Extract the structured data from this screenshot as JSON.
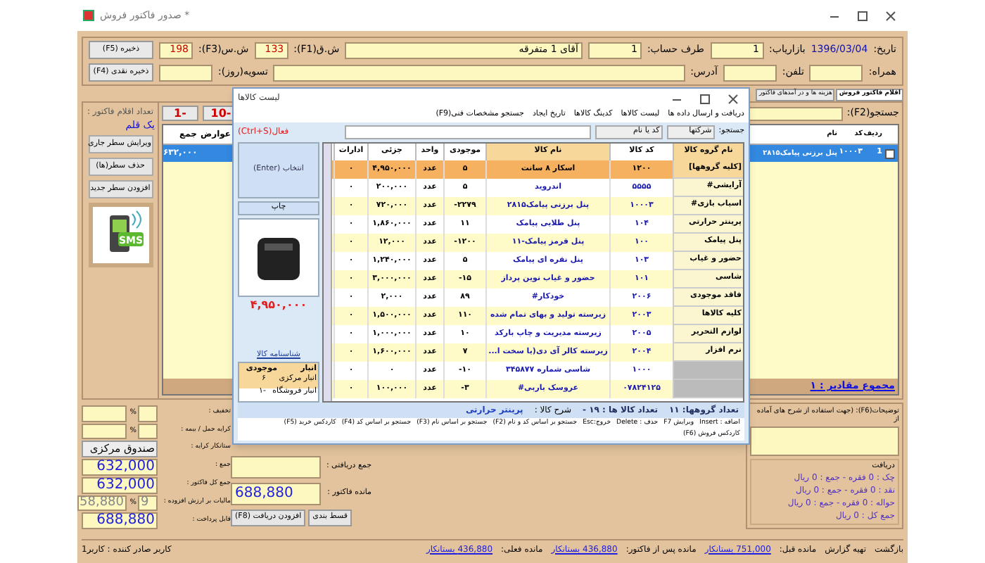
{
  "window": {
    "title": "صدور فاکتور فروش *"
  },
  "header": {
    "row1": [
      {
        "label": "تاریخ:",
        "value": "1396/03/04",
        "kind": "text"
      },
      {
        "label": "بازاریاب:",
        "value": "1",
        "kind": "field"
      },
      {
        "label": "طرف حساب:",
        "value": "1",
        "kind": "field"
      },
      {
        "value": "آقای 1 متفرقه",
        "kind": "wide"
      },
      {
        "label": "ش.ق(F1):",
        "value": "133",
        "kind": "red"
      },
      {
        "label": "ش.س(F3):",
        "value": "198",
        "kind": "red"
      }
    ],
    "save_button": "ذخیره (F5)",
    "row2": [
      {
        "label": "همراه:",
        "kind": "field"
      },
      {
        "label": "تلفن:",
        "kind": "field"
      },
      {
        "label": "آدرس:",
        "kind": "wide"
      },
      {
        "label": "تسویه(روز):",
        "kind": "field"
      }
    ],
    "cash_save_button": "ذخیره نقدی (F4)"
  },
  "tabs": [
    {
      "label": "اقلام فاکتور فروش",
      "selected": true
    },
    {
      "label": "هزینه ها و در آمدهای فاکتور",
      "selected": false
    }
  ],
  "search": {
    "label": "جستجو(F2):"
  },
  "step_buttons": [
    "-10",
    "-1"
  ],
  "side": {
    "count_label": "تعداد اقلام فاکتور :",
    "count": "یک قلم",
    "buttons": [
      "ویرایش سطر جاری",
      "حذف سطر(ها)",
      "افزودن سطر جدید"
    ],
    "sms_label": "SMS"
  },
  "grid": {
    "columns": [
      "ردیف",
      "کد",
      "نام",
      "عوارض",
      "جمع"
    ],
    "rows": [
      {
        "checked": false,
        "number": "1",
        "code": "۱۰۰۰۳",
        "name": "پنل برزنی پیامک۲۸۱۵",
        "total": "۶۳۲,۰۰۰",
        "selected": true
      }
    ],
    "footer": "مجموع مقادیر : ۱"
  },
  "dialog": {
    "title": "لیست کالاها",
    "menu": [
      "دریافت و ارسال داده ها",
      "لیست کالاها",
      "کدینگ کالاها",
      "تاریخ ایجاد",
      "جستجو مشخصات فنی(F9)"
    ],
    "search_label": "جستجو:",
    "combo1": "شرکتها",
    "combo2": "کد یا نام",
    "active_label": "فعال(Ctrl+S)",
    "select_button": "انتخاب (Enter)",
    "print_button": "چاپ",
    "price": "۴,۹۵۰,۰۰۰",
    "id_card_link": "شناسنامه کالا",
    "stock_columns": [
      "انبار",
      "موجودی"
    ],
    "stock": [
      {
        "store": "انبار مرکزی",
        "qty": "۶",
        "selected": true
      },
      {
        "store": "انبار فروشگاه",
        "qty": "-۱",
        "selected": false
      }
    ],
    "group_header": "نام گروه کالا",
    "groups": [
      "[کلیه گروهها]",
      "آرایشی#",
      "اسباب بازی#",
      "پرینتر حرارتی",
      "پنل پیامک",
      "حضور و غیاب",
      "شاسی",
      "فاقد موجودی",
      "کلیه کالاها",
      "لوازم التحریر",
      "نرم افزار"
    ],
    "columns": [
      "کد کالا",
      "نام کالا",
      "موجودی",
      "واحد",
      "جزئی",
      "ادارات"
    ],
    "items": [
      {
        "code": "۱۲۰۰",
        "name": "اسکار ۸ سانت",
        "qty": "۵",
        "unit": "عدد",
        "price": "۴,۹۵۰,۰۰۰",
        "dept": "۰",
        "selected": true
      },
      {
        "code": "۵۵۵۵",
        "name": "اندروید",
        "qty": "۵",
        "unit": "عدد",
        "price": "۲۰۰,۰۰۰",
        "dept": "۰",
        "selected": false
      },
      {
        "code": "۱۰۰۰۳",
        "name": "پنل برزنی پیامک۲۸۱۵",
        "qty": "۲۲۷۹-",
        "unit": "عدد",
        "price": "۷۲۰,۰۰۰",
        "dept": "۰",
        "selected": false
      },
      {
        "code": "۱۰۴",
        "name": "پنل طلایی پیامک",
        "qty": "۱۱",
        "unit": "عدد",
        "price": "۱,۸۶۰,۰۰۰",
        "dept": "۰",
        "selected": false
      },
      {
        "code": "۱۰۰",
        "name": "پنل قرمز پیامک-۱۱",
        "qty": "۱۲۰۰-",
        "unit": "عدد",
        "price": "۱۲,۰۰۰",
        "dept": "۰",
        "selected": false
      },
      {
        "code": "۱۰۳",
        "name": "پنل نقره ای پیامک",
        "qty": "۵",
        "unit": "عدد",
        "price": "۱,۲۴۰,۰۰۰",
        "dept": "۰",
        "selected": false
      },
      {
        "code": "۱۰۱",
        "name": "حضور و غیاب نوین پرداز",
        "qty": "۱۵-",
        "unit": "عدد",
        "price": "۳,۰۰۰,۰۰۰",
        "dept": "۰",
        "selected": false
      },
      {
        "code": "۲۰۰۶",
        "name": "خودکار#",
        "qty": "۸۹",
        "unit": "عدد",
        "price": "۲,۰۰۰",
        "dept": "۰",
        "selected": false
      },
      {
        "code": "۲۰۰۳",
        "name": "زیرسته تولید و بهای تمام شده",
        "qty": "۱۱۰",
        "unit": "عدد",
        "price": "۱,۵۰۰,۰۰۰",
        "dept": "۰",
        "selected": false
      },
      {
        "code": "۲۰۰۵",
        "name": "زیرسته مدیریت و چاپ بارکد",
        "qty": "۱۰",
        "unit": "عدد",
        "price": "۱,۰۰۰,۰۰۰",
        "dept": "۰",
        "selected": false
      },
      {
        "code": "۲۰۰۴",
        "name": "زیرسته کالر آی دی(با سخت ا...",
        "qty": "۷",
        "unit": "عدد",
        "price": "۱,۶۰۰,۰۰۰",
        "dept": "۰",
        "selected": false
      },
      {
        "code": "۱۰۰۰",
        "name": "شاسی شماره ۳۴۵۸۷۷",
        "qty": "۱۰-",
        "unit": "عدد",
        "price": "۰",
        "dept": "۰",
        "selected": false
      },
      {
        "code": "۰۷۸۲۴۱۲۵",
        "name": "عروسک باربی#",
        "qty": "۳-",
        "unit": "عدد",
        "price": "۱۰۰,۰۰۰",
        "dept": "۰",
        "selected": false
      }
    ],
    "group_count": "تعداد گروهها: ۱۱",
    "item_count": "تعداد کالا ها : ۱۹ -",
    "desc_label": "شرح کالا :",
    "desc": "پرینتر حرارتی",
    "shortcuts": [
      "اضافه : Insert",
      "ویرایش F7",
      "حذف : Delete",
      "خروج:Esc",
      "جستجو بر اساس کد و نام (F2)",
      "جستجو بر اساس نام (F3)",
      "جستجو بر اساس کد (F4)",
      "کاردکس خرید (F5)",
      "کاردکس فروش (F6)"
    ]
  },
  "totals": {
    "discount_label": "تخفیف :",
    "freight_label": "کرایه حمل / بیمه :",
    "percent": "%",
    "creditor_label": "ستانکار کرایه :",
    "creditor": "صندوق مرکزی",
    "sum_label": "جمع :",
    "sum": "632,000",
    "invoice_total_label": "جمع کل فاکتور :",
    "invoice_total": "632,000",
    "vat_label": "مالیات بر ارزش افزوده :",
    "vat_rate": "9",
    "vat": "58,880",
    "payable_label": "قابل پرداخت :",
    "payable": "688,880"
  },
  "receipts": {
    "received_label": "جمع دریافتی :",
    "balance_label": "مانده فاکتور :",
    "balance": "688,880",
    "buttons": [
      "قسط بندی",
      "افزودن دریافت (F8)"
    ]
  },
  "notes": {
    "label": "توضیحات(F6): (جهت استفاده از شرح های آماده از",
    "receipt_title": "دریافت",
    "lines": [
      "چک : 0 فقره - جمع : 0 ریال",
      "نقد : 0 فقره - جمع : 0 ریال",
      "حواله : 0 فقره - جمع : 0 ریال",
      "جمع کل : 0 ریال"
    ]
  },
  "status_bar": {
    "user": "کاربر صادر کننده : کاربر1",
    "items": [
      "بازگشت",
      "تهیه گزارش"
    ],
    "balances": [
      {
        "label": "مانده قبل:",
        "value": "751,000 بستانکار"
      },
      {
        "label": "مانده پس از فاکتور:",
        "value": "436,880 بستانکار"
      },
      {
        "label": "مانده فعلی:",
        "value": "436,880 بستانکار"
      }
    ]
  }
}
